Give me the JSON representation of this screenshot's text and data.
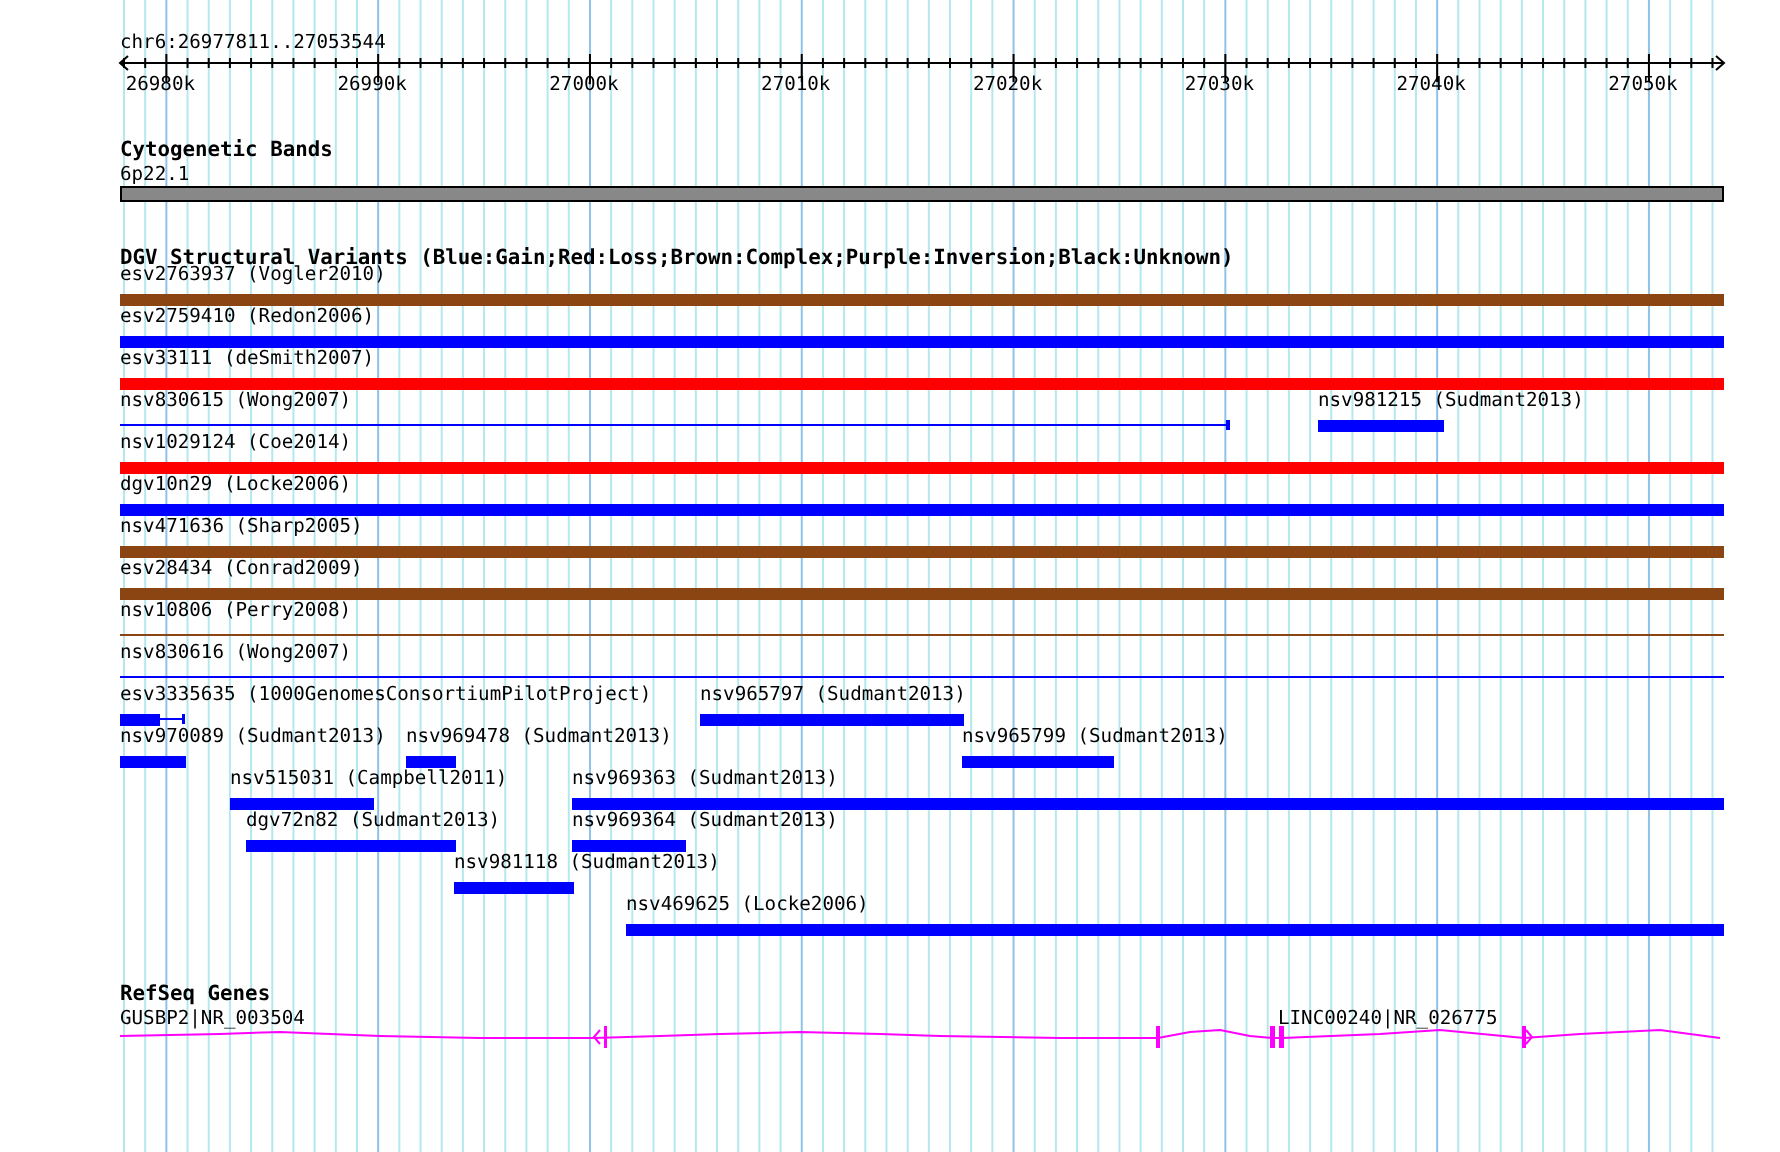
{
  "ruler": {
    "title": "chr6:26977811..27053544",
    "tick_labels": [
      "26980k",
      "26990k",
      "27000k",
      "27010k",
      "27020k",
      "27030k",
      "27040k",
      "27050k"
    ]
  },
  "cytogenetic_bands": {
    "title": "Cytogenetic Bands",
    "bands": [
      {
        "label": "6p22.1"
      }
    ]
  },
  "dgv_variants": {
    "title": "DGV Structural Variants (Blue:Gain;Red:Loss;Brown:Complex;Purple:Inversion;Black:Unknown)",
    "rows": [
      {
        "features": [
          {
            "label": "esv2763937 (Vogler2010)",
            "color": "#8b4513",
            "kind": "bar"
          }
        ]
      },
      {
        "features": [
          {
            "label": "esv2759410 (Redon2006)",
            "color": "#0000ff",
            "kind": "bar"
          }
        ]
      },
      {
        "features": [
          {
            "label": "esv33111 (deSmith2007)",
            "color": "#ff0000",
            "kind": "bar"
          }
        ]
      },
      {
        "features": [
          {
            "label": "nsv830615 (Wong2007)",
            "color": "#0000ff",
            "kind": "line"
          },
          {
            "label": "nsv981215 (Sudmant2013)",
            "color": "#0000ff",
            "kind": "bar"
          }
        ]
      },
      {
        "features": [
          {
            "label": "nsv1029124 (Coe2014)",
            "color": "#ff0000",
            "kind": "bar"
          }
        ]
      },
      {
        "features": [
          {
            "label": "dgv10n29 (Locke2006)",
            "color": "#0000ff",
            "kind": "bar"
          }
        ]
      },
      {
        "features": [
          {
            "label": "nsv471636 (Sharp2005)",
            "color": "#8b4513",
            "kind": "bar"
          }
        ]
      },
      {
        "features": [
          {
            "label": "esv28434 (Conrad2009)",
            "color": "#8b4513",
            "kind": "bar"
          }
        ]
      },
      {
        "features": [
          {
            "label": "nsv10806 (Perry2008)",
            "color": "#8b4513",
            "kind": "line"
          }
        ]
      },
      {
        "features": [
          {
            "label": "nsv830616 (Wong2007)",
            "color": "#0000ff",
            "kind": "line"
          }
        ]
      },
      {
        "features": [
          {
            "label": "esv3335635 (1000GenomesConsortiumPilotProject)",
            "color": "#0000ff",
            "kind": "split"
          },
          {
            "label": "nsv965797 (Sudmant2013)",
            "color": "#0000ff",
            "kind": "bar"
          }
        ]
      },
      {
        "features": [
          {
            "label": "nsv970089 (Sudmant2013)",
            "color": "#0000ff",
            "kind": "bar"
          },
          {
            "label": "nsv969478 (Sudmant2013)",
            "color": "#0000ff",
            "kind": "bar"
          },
          {
            "label": "nsv965799 (Sudmant2013)",
            "color": "#0000ff",
            "kind": "bar"
          }
        ]
      },
      {
        "features": [
          {
            "label": "nsv515031 (Campbell2011)",
            "color": "#0000ff",
            "kind": "bar"
          },
          {
            "label": "nsv969363 (Sudmant2013)",
            "color": "#0000ff",
            "kind": "bar"
          }
        ]
      },
      {
        "features": [
          {
            "label": "dgv72n82 (Sudmant2013)",
            "color": "#0000ff",
            "kind": "bar"
          },
          {
            "label": "nsv969364 (Sudmant2013)",
            "color": "#0000ff",
            "kind": "bar"
          }
        ]
      },
      {
        "features": [
          {
            "label": "nsv981118 (Sudmant2013)",
            "color": "#0000ff",
            "kind": "bar"
          }
        ]
      },
      {
        "features": [
          {
            "label": "nsv469625 (Locke2006)",
            "color": "#0000ff",
            "kind": "bar"
          }
        ]
      }
    ]
  },
  "refseq_genes": {
    "title": "RefSeq Genes",
    "genes": [
      {
        "label": "GUSBP2|NR_003504"
      },
      {
        "label": "LINC00240|NR_026775"
      }
    ]
  }
}
